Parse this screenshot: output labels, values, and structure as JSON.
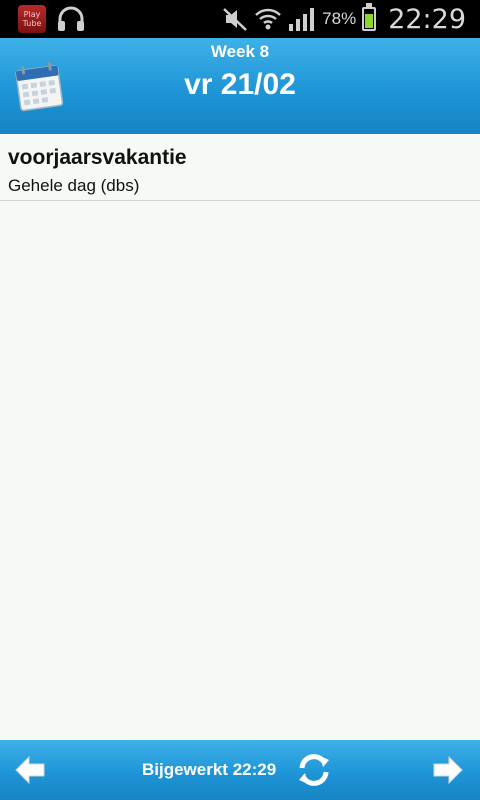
{
  "status_bar": {
    "app_icon_line1": "Play",
    "app_icon_line2": "Tube",
    "battery_percent": "78%",
    "battery_level": 0.78,
    "time": "22:29",
    "icons": [
      "playtube-icon",
      "headphones-icon",
      "mute-icon",
      "wifi-icon",
      "signal-icon",
      "battery-icon"
    ]
  },
  "header": {
    "week": "Week 8",
    "date": "vr 21/02",
    "icon": "calendar-icon"
  },
  "events": [
    {
      "title": "voorjaarsvakantie",
      "subtitle": "Gehele dag (dbs)"
    }
  ],
  "footer": {
    "updated_label": "Bijgewerkt 22:29",
    "prev_icon": "arrow-left-icon",
    "refresh_icon": "refresh-icon",
    "next_icon": "arrow-right-icon"
  },
  "colors": {
    "header_blue": "#1e95d6",
    "background": "#f6f9f6",
    "status_bar": "#000000",
    "battery_green": "#8ad62a"
  }
}
